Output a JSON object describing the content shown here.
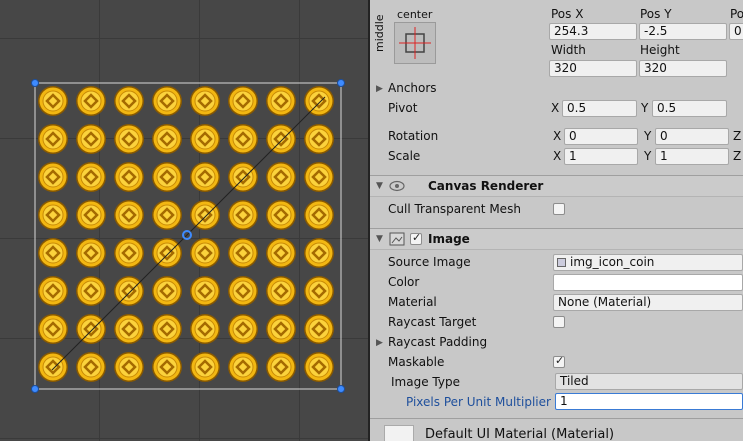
{
  "scene": {
    "coin_rows": 8,
    "coin_cols": 8,
    "handle_color": "#3e8bff",
    "coin_color": "#f2b712"
  },
  "rect": {
    "anchor_h": "center",
    "anchor_v": "middle",
    "pos_x_label": "Pos X",
    "pos_y_label": "Pos Y",
    "pos_z_label": "Po",
    "pos_x": "254.3",
    "pos_y": "-2.5",
    "pos_z": "0",
    "width_label": "Width",
    "height_label": "Height",
    "width": "320",
    "height": "320",
    "anchors_label": "Anchors",
    "pivot_label": "Pivot",
    "pivot_x_label": "X",
    "pivot_x": "0.5",
    "pivot_y_label": "Y",
    "pivot_y": "0.5",
    "rotation_label": "Rotation",
    "rot_x_label": "X",
    "rot_x": "0",
    "rot_y_label": "Y",
    "rot_y": "0",
    "rot_z_label": "Z",
    "scale_label": "Scale",
    "scale_x_label": "X",
    "scale_x": "1",
    "scale_y_label": "Y",
    "scale_y": "1",
    "scale_z_label": "Z"
  },
  "canvas_renderer": {
    "title": "Canvas Renderer",
    "cull_label": "Cull Transparent Mesh",
    "cull_checked": false
  },
  "image": {
    "title": "Image",
    "enabled": true,
    "source_image_label": "Source Image",
    "source_image_value": "img_icon_coin",
    "color_label": "Color",
    "material_label": "Material",
    "material_value": "None (Material)",
    "raycast_target_label": "Raycast Target",
    "raycast_target_checked": false,
    "raycast_padding_label": "Raycast Padding",
    "maskable_label": "Maskable",
    "maskable_checked": true,
    "image_type_label": "Image Type",
    "image_type_value": "Tiled",
    "ppu_label": "Pixels Per Unit Multiplier",
    "ppu_value": "1"
  },
  "footer": {
    "material_name": "Default UI Material (Material)"
  }
}
